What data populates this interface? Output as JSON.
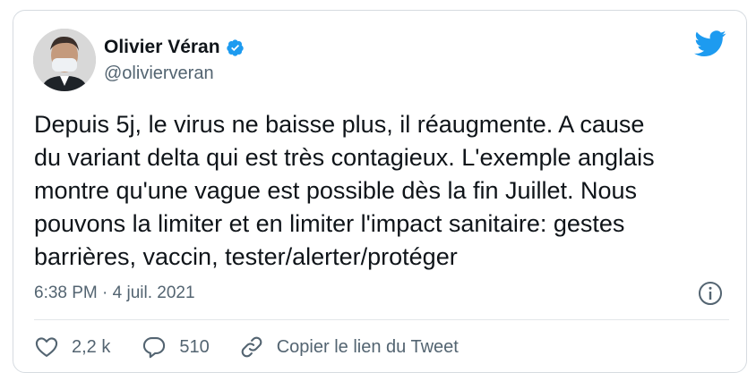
{
  "author": {
    "name": "Olivier Véran",
    "handle": "@olivierveran",
    "verified": true
  },
  "tweet": {
    "text": "Depuis 5j, le virus ne baisse plus, il réaugmente. A cause\ndu variant delta qui est très contagieux. L'exemple anglais\nmontre qu'une vague est possible dès la fin Juillet. Nous\npouvons la limiter et en limiter l'impact sanitaire: gestes\nbarrières, vaccin, tester/alerter/protéger",
    "timestamp": "6:38 PM · 4 juil. 2021"
  },
  "actions": {
    "likes": "2,2 k",
    "replies": "510",
    "copy_link_label": "Copier le lien du Tweet"
  },
  "icons": {
    "brand": "twitter-bird-icon",
    "verified": "verified-badge-icon",
    "info": "info-icon",
    "like": "heart-icon",
    "reply": "speech-bubble-icon",
    "copy": "link-icon"
  },
  "colors": {
    "brand_blue": "#1d9bf0",
    "text_primary": "#0f1419",
    "text_secondary": "#536471",
    "border": "#d6dbe0"
  }
}
